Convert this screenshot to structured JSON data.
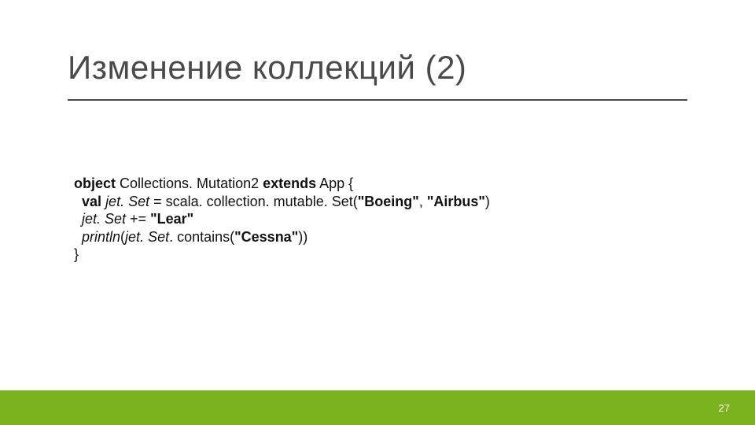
{
  "slide": {
    "title": "Изменение коллекций (2)",
    "page_number": "27"
  },
  "code": {
    "l1": {
      "p1": "object",
      "p2": " Collections. Mutation2 ",
      "p3": "extends",
      "p4": " App {"
    },
    "l2": {
      "p1": "  ",
      "p2": "val",
      "p3": " ",
      "p4": "jet. Set",
      "p5": " = scala. collection. mutable. Set(",
      "p6": "\"Boeing\"",
      "p7": ", ",
      "p8": "\"Airbus\"",
      "p9": ")"
    },
    "l3": {
      "p1": "  ",
      "p2": "jet. Set",
      "p3": " += ",
      "p4": "\"Lear\""
    },
    "l4": {
      "p1": "  ",
      "p2": "println",
      "p3": "(",
      "p4": "jet. Set",
      "p5": ". contains(",
      "p6": "\"Cessna\"",
      "p7": "))"
    },
    "l5": {
      "p1": "}"
    }
  }
}
